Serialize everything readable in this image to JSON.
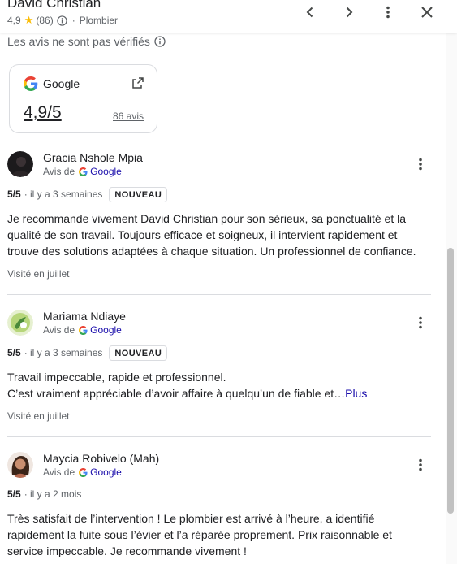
{
  "header": {
    "title": "David Christian",
    "rating": "4,9",
    "review_count": "(86)",
    "category": "Plombier",
    "icons": [
      "chevron-left-icon",
      "chevron-right-icon",
      "more-vert-icon",
      "close-icon"
    ]
  },
  "disclaimer": "Les avis ne sont pas vérifiés",
  "source_card": {
    "name": "Google",
    "rating": "4,9/5",
    "count": "86 avis"
  },
  "colors": {
    "star": "#fbbc04",
    "link": "#1a0dab",
    "divider": "#dadce0",
    "secondary_text": "#5f6368"
  },
  "reviews": [
    {
      "name": "Gracia Nshole Mpia",
      "via": "Avis de",
      "source": "Google",
      "score": "5/5",
      "when": "· il y a 3 semaines",
      "badge": "NOUVEAU",
      "lines": [
        "Je recommande vivement David Christian pour son sérieux, sa ponctualité et la",
        "qualité de son travail. Toujours efficace et soigneux, il intervient rapidement et",
        "trouve des solutions adaptées à chaque situation. Un professionnel de confiance."
      ],
      "visited": "Visité en juillet"
    },
    {
      "name": "Mariama Ndiaye",
      "via": "Avis de",
      "source": "Google",
      "score": "5/5",
      "when": "· il y a 3 semaines",
      "badge": "NOUVEAU",
      "lines": [
        "Travail impeccable, rapide et professionnel.",
        "C’est vraiment appréciable d’avoir affaire à quelqu’un de fiable et…"
      ],
      "more_label": "Plus",
      "visited": "Visité en juillet"
    },
    {
      "name": "Maycia Robivelo (Mah)",
      "via": "Avis de",
      "source": "Google",
      "score": "5/5",
      "when": "· il y a 2 mois",
      "lines": [
        "Très satisfait de l’intervention ! Le plombier est arrivé à l’heure, a identifié",
        "rapidement la fuite sous l’évier et l’a réparée proprement. Prix raisonnable et",
        "service impeccable. Je recommande vivement !"
      ]
    }
  ]
}
